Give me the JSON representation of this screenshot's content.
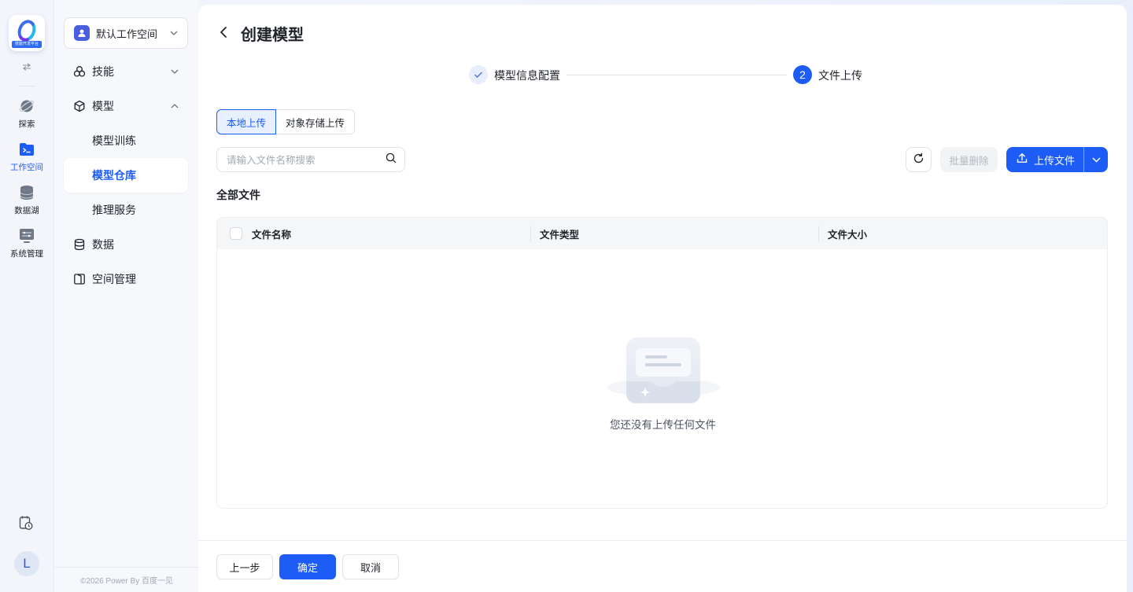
{
  "app": {
    "logo_tag": "技能开发平台",
    "avatar_letter": "L"
  },
  "rail": {
    "items": [
      {
        "label": "探索",
        "icon": "planet-icon"
      },
      {
        "label": "工作空间",
        "icon": "workspace-folder-icon",
        "active": true
      },
      {
        "label": "数据湖",
        "icon": "database-icon"
      },
      {
        "label": "系统管理",
        "icon": "system-settings-icon"
      }
    ]
  },
  "sidebar": {
    "workspace_label": "默认工作空间",
    "menu": [
      {
        "label": "技能",
        "icon": "skills-icon"
      },
      {
        "label": "模型",
        "icon": "cube-icon"
      },
      {
        "label": "模型训练"
      },
      {
        "label": "模型仓库",
        "active": true
      },
      {
        "label": "推理服务"
      },
      {
        "label": "数据",
        "icon": "data-icon"
      },
      {
        "label": "空间管理",
        "icon": "space-icon"
      }
    ],
    "copyright": "©2026 Power By 百度一见"
  },
  "page": {
    "title": "创建模型",
    "steps": [
      {
        "label": "模型信息配置",
        "status": "done"
      },
      {
        "number": "2",
        "label": "文件上传",
        "status": "current"
      }
    ],
    "upload_tabs": [
      "本地上传",
      "对象存储上传"
    ],
    "search_placeholder": "请输入文件名称搜索",
    "batch_delete": "批量删除",
    "upload_file": "上传文件",
    "section_title": "全部文件",
    "table_headers": [
      "文件名称",
      "文件类型",
      "文件大小"
    ],
    "empty_text": "您还没有上传任何文件",
    "footer": {
      "prev": "上一步",
      "confirm": "确定",
      "cancel": "取消"
    }
  },
  "colors": {
    "primary": "#1d5cf5",
    "primary_light": "#e8f0ff",
    "text": "#1f2329",
    "muted": "#a3a8b2"
  }
}
